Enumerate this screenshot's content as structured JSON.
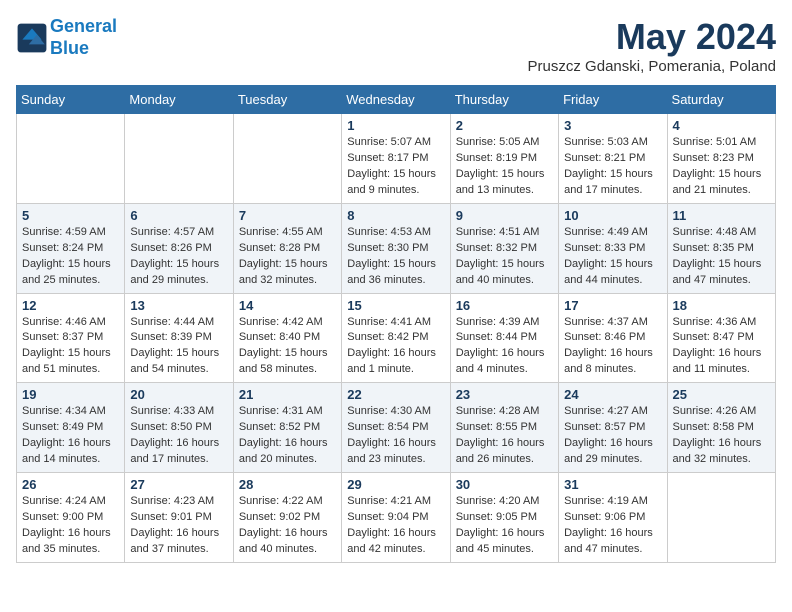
{
  "logo": {
    "line1": "General",
    "line2": "Blue"
  },
  "title": "May 2024",
  "location": "Pruszcz Gdanski, Pomerania, Poland",
  "weekdays": [
    "Sunday",
    "Monday",
    "Tuesday",
    "Wednesday",
    "Thursday",
    "Friday",
    "Saturday"
  ],
  "weeks": [
    [
      {
        "day": "",
        "info": ""
      },
      {
        "day": "",
        "info": ""
      },
      {
        "day": "",
        "info": ""
      },
      {
        "day": "1",
        "info": "Sunrise: 5:07 AM\nSunset: 8:17 PM\nDaylight: 15 hours\nand 9 minutes."
      },
      {
        "day": "2",
        "info": "Sunrise: 5:05 AM\nSunset: 8:19 PM\nDaylight: 15 hours\nand 13 minutes."
      },
      {
        "day": "3",
        "info": "Sunrise: 5:03 AM\nSunset: 8:21 PM\nDaylight: 15 hours\nand 17 minutes."
      },
      {
        "day": "4",
        "info": "Sunrise: 5:01 AM\nSunset: 8:23 PM\nDaylight: 15 hours\nand 21 minutes."
      }
    ],
    [
      {
        "day": "5",
        "info": "Sunrise: 4:59 AM\nSunset: 8:24 PM\nDaylight: 15 hours\nand 25 minutes."
      },
      {
        "day": "6",
        "info": "Sunrise: 4:57 AM\nSunset: 8:26 PM\nDaylight: 15 hours\nand 29 minutes."
      },
      {
        "day": "7",
        "info": "Sunrise: 4:55 AM\nSunset: 8:28 PM\nDaylight: 15 hours\nand 32 minutes."
      },
      {
        "day": "8",
        "info": "Sunrise: 4:53 AM\nSunset: 8:30 PM\nDaylight: 15 hours\nand 36 minutes."
      },
      {
        "day": "9",
        "info": "Sunrise: 4:51 AM\nSunset: 8:32 PM\nDaylight: 15 hours\nand 40 minutes."
      },
      {
        "day": "10",
        "info": "Sunrise: 4:49 AM\nSunset: 8:33 PM\nDaylight: 15 hours\nand 44 minutes."
      },
      {
        "day": "11",
        "info": "Sunrise: 4:48 AM\nSunset: 8:35 PM\nDaylight: 15 hours\nand 47 minutes."
      }
    ],
    [
      {
        "day": "12",
        "info": "Sunrise: 4:46 AM\nSunset: 8:37 PM\nDaylight: 15 hours\nand 51 minutes."
      },
      {
        "day": "13",
        "info": "Sunrise: 4:44 AM\nSunset: 8:39 PM\nDaylight: 15 hours\nand 54 minutes."
      },
      {
        "day": "14",
        "info": "Sunrise: 4:42 AM\nSunset: 8:40 PM\nDaylight: 15 hours\nand 58 minutes."
      },
      {
        "day": "15",
        "info": "Sunrise: 4:41 AM\nSunset: 8:42 PM\nDaylight: 16 hours\nand 1 minute."
      },
      {
        "day": "16",
        "info": "Sunrise: 4:39 AM\nSunset: 8:44 PM\nDaylight: 16 hours\nand 4 minutes."
      },
      {
        "day": "17",
        "info": "Sunrise: 4:37 AM\nSunset: 8:46 PM\nDaylight: 16 hours\nand 8 minutes."
      },
      {
        "day": "18",
        "info": "Sunrise: 4:36 AM\nSunset: 8:47 PM\nDaylight: 16 hours\nand 11 minutes."
      }
    ],
    [
      {
        "day": "19",
        "info": "Sunrise: 4:34 AM\nSunset: 8:49 PM\nDaylight: 16 hours\nand 14 minutes."
      },
      {
        "day": "20",
        "info": "Sunrise: 4:33 AM\nSunset: 8:50 PM\nDaylight: 16 hours\nand 17 minutes."
      },
      {
        "day": "21",
        "info": "Sunrise: 4:31 AM\nSunset: 8:52 PM\nDaylight: 16 hours\nand 20 minutes."
      },
      {
        "day": "22",
        "info": "Sunrise: 4:30 AM\nSunset: 8:54 PM\nDaylight: 16 hours\nand 23 minutes."
      },
      {
        "day": "23",
        "info": "Sunrise: 4:28 AM\nSunset: 8:55 PM\nDaylight: 16 hours\nand 26 minutes."
      },
      {
        "day": "24",
        "info": "Sunrise: 4:27 AM\nSunset: 8:57 PM\nDaylight: 16 hours\nand 29 minutes."
      },
      {
        "day": "25",
        "info": "Sunrise: 4:26 AM\nSunset: 8:58 PM\nDaylight: 16 hours\nand 32 minutes."
      }
    ],
    [
      {
        "day": "26",
        "info": "Sunrise: 4:24 AM\nSunset: 9:00 PM\nDaylight: 16 hours\nand 35 minutes."
      },
      {
        "day": "27",
        "info": "Sunrise: 4:23 AM\nSunset: 9:01 PM\nDaylight: 16 hours\nand 37 minutes."
      },
      {
        "day": "28",
        "info": "Sunrise: 4:22 AM\nSunset: 9:02 PM\nDaylight: 16 hours\nand 40 minutes."
      },
      {
        "day": "29",
        "info": "Sunrise: 4:21 AM\nSunset: 9:04 PM\nDaylight: 16 hours\nand 42 minutes."
      },
      {
        "day": "30",
        "info": "Sunrise: 4:20 AM\nSunset: 9:05 PM\nDaylight: 16 hours\nand 45 minutes."
      },
      {
        "day": "31",
        "info": "Sunrise: 4:19 AM\nSunset: 9:06 PM\nDaylight: 16 hours\nand 47 minutes."
      },
      {
        "day": "",
        "info": ""
      }
    ]
  ]
}
